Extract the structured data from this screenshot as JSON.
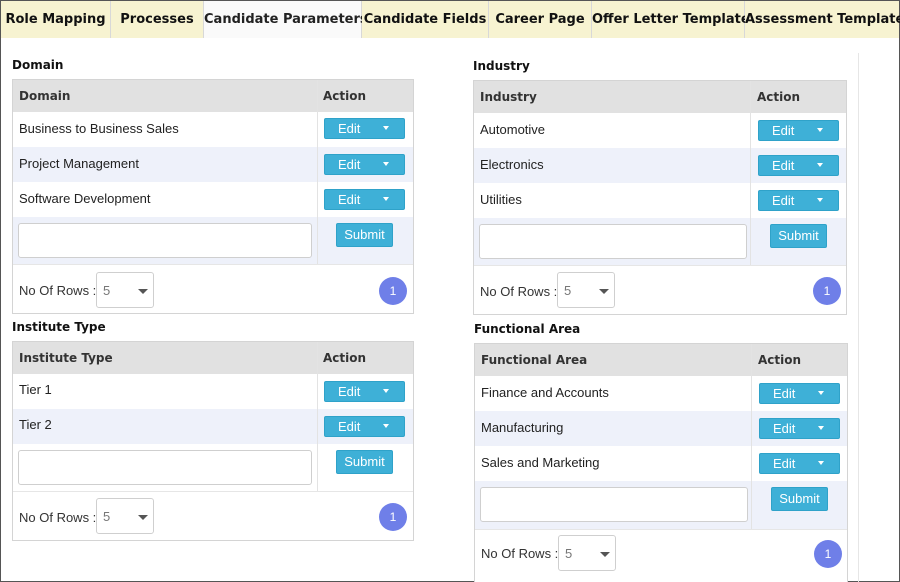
{
  "tabs": [
    {
      "label": "Role Mapping"
    },
    {
      "label": "Processes"
    },
    {
      "label": "Candidate Parameters"
    },
    {
      "label": "Candidate Fields"
    },
    {
      "label": "Career Page"
    },
    {
      "label": "Offer Letter Template"
    },
    {
      "label": "Assessment Templates"
    }
  ],
  "active_tab": "Candidate Parameters",
  "colors": {
    "tab_bar": "#f7f3d1",
    "button": "#3eb0d7",
    "page_badge": "#6f7fe8",
    "zebra_row": "#eef1fa",
    "header_row": "#e1e1e1"
  },
  "common": {
    "edit_label": "Edit",
    "submit_label": "Submit",
    "rows_label": "No Of Rows :",
    "rows_value": "5",
    "page_number": "1",
    "input_value": ""
  },
  "panels": {
    "domain": {
      "title": "Domain",
      "col_name": "Domain",
      "col_action": "Action",
      "rows": [
        "Business to Business Sales",
        "Project Management",
        "Software Development"
      ]
    },
    "industry": {
      "title": "Industry",
      "col_name": "Industry",
      "col_action": "Action",
      "rows": [
        "Automotive",
        "Electronics",
        "Utilities"
      ]
    },
    "institute_type": {
      "title": "Institute Type",
      "col_name": "Institute Type",
      "col_action": "Action",
      "rows": [
        "Tier 1",
        "Tier 2"
      ]
    },
    "functional_area": {
      "title": "Functional Area",
      "col_name": "Functional Area",
      "col_action": "Action",
      "rows": [
        "Finance and Accounts",
        "Manufacturing",
        "Sales and Marketing"
      ]
    }
  },
  "icons": {
    "edit_dropdown": "caret-down-icon",
    "rows_select": "chevron-down-icon"
  }
}
